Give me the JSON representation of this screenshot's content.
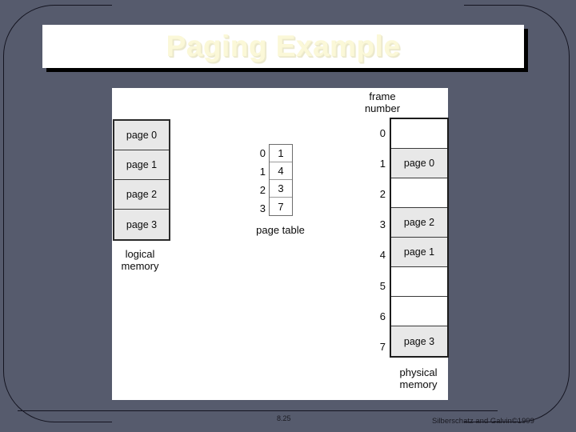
{
  "slide": {
    "title": "Paging Example",
    "slide_number": "8.25",
    "credit": "Silberschatz and Galvin©1999",
    "background_color": "#565b6d",
    "title_color": "#fbf8d8",
    "banner_color": "#ffffff"
  },
  "diagram": {
    "logical_memory": {
      "label_line1": "logical",
      "label_line2": "memory",
      "cells": [
        {
          "label": "page 0"
        },
        {
          "label": "page 1"
        },
        {
          "label": "page 2"
        },
        {
          "label": "page 3"
        }
      ]
    },
    "page_table": {
      "label": "page table",
      "indices": [
        "0",
        "1",
        "2",
        "3"
      ],
      "entries": [
        "1",
        "4",
        "3",
        "7"
      ]
    },
    "physical_memory": {
      "header_line1": "frame",
      "header_line2": "number",
      "label_line1": "physical",
      "label_line2": "memory",
      "indices": [
        "0",
        "1",
        "2",
        "3",
        "4",
        "5",
        "6",
        "7"
      ],
      "frames": [
        {
          "index": "0",
          "content": ""
        },
        {
          "index": "1",
          "content": "page 0"
        },
        {
          "index": "2",
          "content": ""
        },
        {
          "index": "3",
          "content": "page 2"
        },
        {
          "index": "4",
          "content": "page 1"
        },
        {
          "index": "5",
          "content": ""
        },
        {
          "index": "6",
          "content": ""
        },
        {
          "index": "7",
          "content": "page 3"
        }
      ]
    }
  }
}
